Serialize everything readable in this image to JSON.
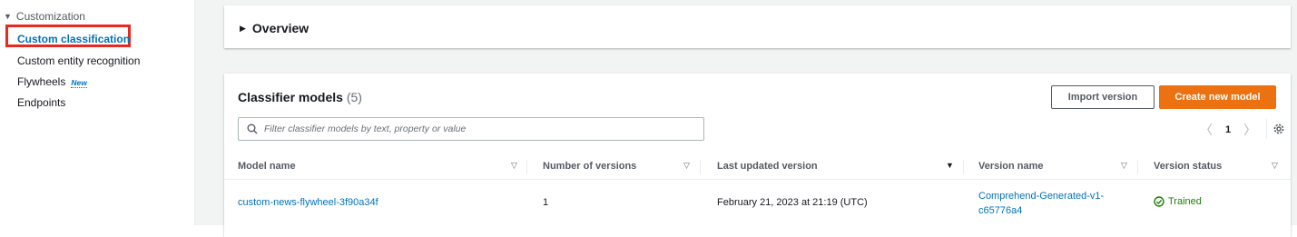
{
  "sidebar": {
    "section_label": "Customization",
    "items": [
      {
        "label": "Custom classification"
      },
      {
        "label": "Custom entity recognition"
      },
      {
        "label": "Flywheels",
        "badge": "New"
      },
      {
        "label": "Endpoints"
      }
    ]
  },
  "overview": {
    "title": "Overview"
  },
  "models": {
    "title": "Classifier models",
    "count": "(5)",
    "import_label": "Import version",
    "create_label": "Create new model",
    "filter_placeholder": "Filter classifier models by text, property or value",
    "current_page": "1",
    "columns": [
      "Model name",
      "Number of versions",
      "Last updated version",
      "Version name",
      "Version status"
    ],
    "rows": [
      {
        "model_name": "custom-news-flywheel-3f90a34f",
        "num_versions": "1",
        "last_updated": "February 21, 2023 at 21:19 (UTC)",
        "version_name_line1": "Comprehend-Generated-v1-",
        "version_name_line2": "c65776a4",
        "status": "Trained"
      }
    ]
  },
  "colors": {
    "accent": "#0073bb",
    "primary_button": "#ec7211",
    "success": "#1d8102",
    "highlight_box": "#e8291f"
  }
}
